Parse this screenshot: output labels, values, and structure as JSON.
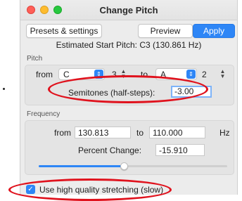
{
  "window": {
    "title": "Change Pitch"
  },
  "toolbar": {
    "presets_label": "Presets & settings",
    "preview_label": "Preview",
    "apply_label": "Apply"
  },
  "estimated_start_pitch": "Estimated Start Pitch: C3 (130.861 Hz)",
  "pitch": {
    "section_label": "Pitch",
    "from_label": "from",
    "from_note": "C",
    "from_octave": "3",
    "to_label": "to",
    "to_note": "A",
    "to_octave": "2",
    "semitones_label": "Semitones (half-steps):",
    "semitones_value": "-3.00"
  },
  "frequency": {
    "section_label": "Frequency",
    "from_label": "from",
    "from_value": "130.813",
    "to_label": "to",
    "to_value": "110.000",
    "unit": "Hz",
    "percent_label": "Percent Change:",
    "percent_value": "-15.910",
    "slider_value_fraction": 0.45
  },
  "options": {
    "high_quality_label": "Use high quality stretching (slow)",
    "high_quality_checked": true
  },
  "colors": {
    "accent": "#2e86f6",
    "annotation": "#e0121d"
  }
}
